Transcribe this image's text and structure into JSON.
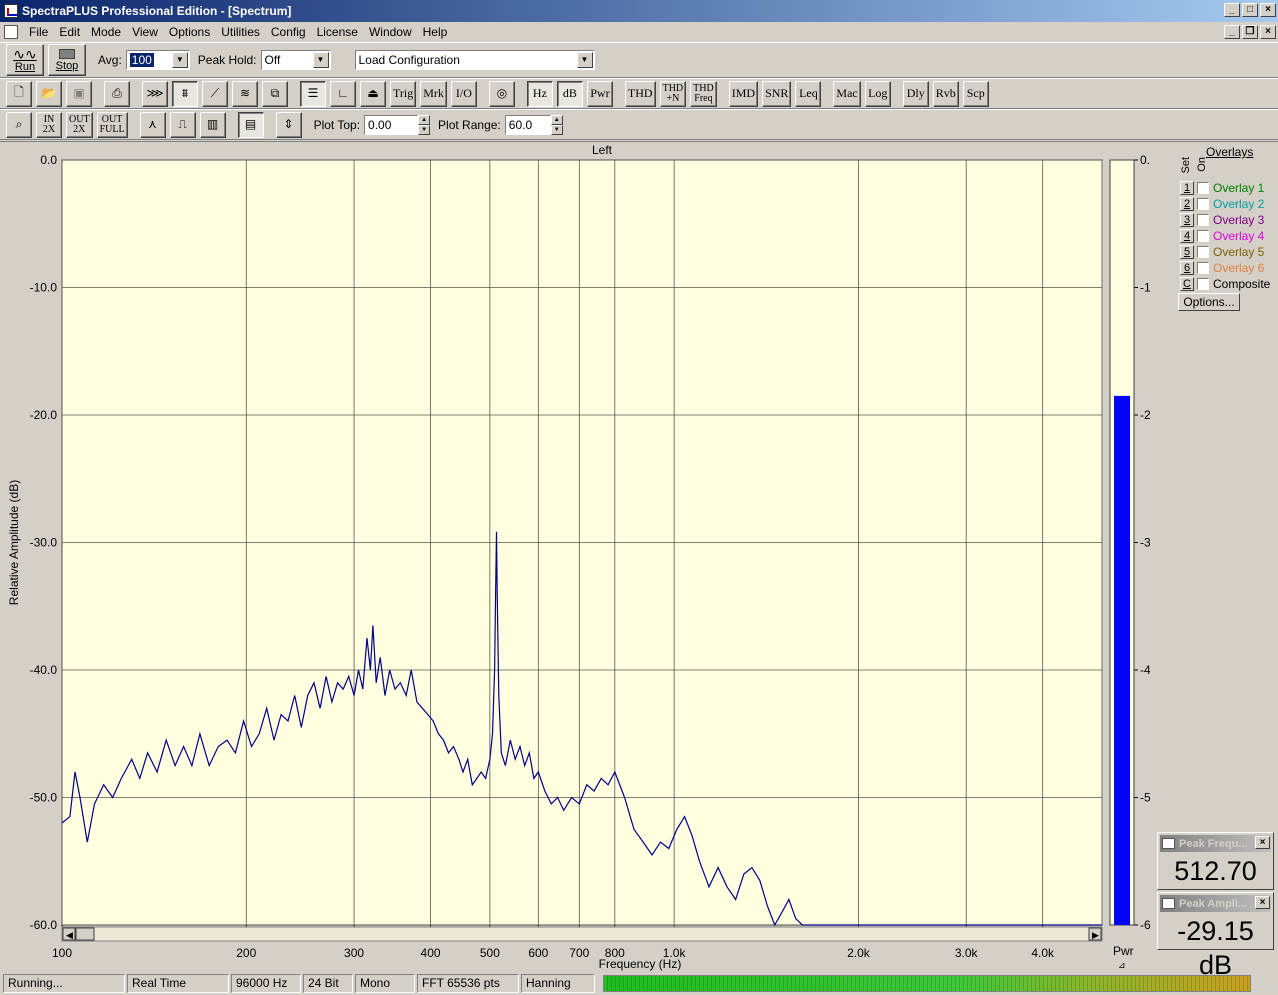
{
  "window": {
    "title": "SpectraPLUS Professional Edition - [Spectrum]"
  },
  "menu": [
    "File",
    "Edit",
    "Mode",
    "View",
    "Options",
    "Utilities",
    "Config",
    "License",
    "Window",
    "Help"
  ],
  "toolbar1": {
    "run_label": "Run",
    "stop_label": "Stop",
    "avg_label": "Avg:",
    "avg_value": "100",
    "peak_hold_label": "Peak Hold:",
    "peak_hold_value": "Off",
    "config_value": "Load Configuration"
  },
  "toolbar2": {
    "text_buttons": [
      "Trig",
      "Mrk",
      "I/O",
      "Hz",
      "dB",
      "Pwr",
      "THD",
      "IMD",
      "SNR",
      "Leq",
      "Mac",
      "Log",
      "Dly",
      "Rvb",
      "Scp"
    ],
    "thdn_top": "THD",
    "thdn_bottom": "+N",
    "thdfreq_top": "THD",
    "thdfreq_bottom": "Freq"
  },
  "toolbar3": {
    "zoom_in_label": [
      "IN",
      "2X"
    ],
    "zoom_out_label": [
      "OUT",
      "2X"
    ],
    "zoom_full_label": [
      "OUT",
      "FULL"
    ],
    "plot_top_label": "Plot Top:",
    "plot_top_value": "0.00",
    "plot_range_label": "Plot Range:",
    "plot_range_value": "60.0"
  },
  "overlays": {
    "title": "Overlays",
    "set_label": "Set",
    "on_label": "On",
    "items": [
      {
        "set": "1",
        "name": "Overlay 1",
        "color": "#008000"
      },
      {
        "set": "2",
        "name": "Overlay 2",
        "color": "#00a0a0"
      },
      {
        "set": "3",
        "name": "Overlay 3",
        "color": "#800080"
      },
      {
        "set": "4",
        "name": "Overlay 4",
        "color": "#e000e0"
      },
      {
        "set": "5",
        "name": "Overlay 5",
        "color": "#806000"
      },
      {
        "set": "6",
        "name": "Overlay 6",
        "color": "#e08040"
      },
      {
        "set": "C",
        "name": "Composite",
        "color": "#000000"
      }
    ],
    "options_label": "Options..."
  },
  "peak_freq": {
    "title": "Peak Frequ...",
    "value": "512.70 Hz"
  },
  "peak_amp": {
    "title": "Peak Ampli...",
    "value": "-29.15 dB"
  },
  "status": {
    "state": "Running...",
    "mode": "Real Time",
    "rate": "96000 Hz",
    "bits": "24 Bit",
    "channels": "Mono",
    "fft": "FFT 65536 pts",
    "window": "Hanning"
  },
  "chart_data": {
    "type": "line",
    "title": "Left",
    "xlabel": "Frequency (Hz)",
    "ylabel": "Relative Amplitude (dB)",
    "x_scale": "log",
    "xlim": [
      100,
      5000
    ],
    "ylim": [
      -60,
      0
    ],
    "x_ticks": [
      100,
      200,
      300,
      400,
      500,
      600,
      700,
      800,
      1000,
      2000,
      3000,
      4000
    ],
    "x_tick_labels": [
      "100",
      "200",
      "300",
      "400",
      "500",
      "600",
      "700",
      "800",
      "1.0k",
      "2.0k",
      "3.0k",
      "4.0k"
    ],
    "y_ticks": [
      0,
      -10,
      -20,
      -30,
      -40,
      -50,
      -60
    ],
    "y_tick_labels": [
      "0.0",
      "-10.0",
      "-20.0",
      "-30.0",
      "-40.0",
      "-50.0",
      "-60.0"
    ],
    "grid": true,
    "series": [
      {
        "color": "#00008b",
        "points": [
          [
            100,
            -52
          ],
          [
            103,
            -51.5
          ],
          [
            105,
            -48
          ],
          [
            107,
            -50
          ],
          [
            110,
            -53.5
          ],
          [
            113,
            -50.5
          ],
          [
            117,
            -49
          ],
          [
            121,
            -50
          ],
          [
            125,
            -48.5
          ],
          [
            130,
            -47
          ],
          [
            134,
            -48.5
          ],
          [
            138,
            -46.5
          ],
          [
            143,
            -48
          ],
          [
            148,
            -45.5
          ],
          [
            153,
            -47.5
          ],
          [
            158,
            -46
          ],
          [
            163,
            -47.5
          ],
          [
            168,
            -45
          ],
          [
            174,
            -47.5
          ],
          [
            180,
            -46
          ],
          [
            186,
            -45.5
          ],
          [
            192,
            -46.5
          ],
          [
            198,
            -44
          ],
          [
            204,
            -46
          ],
          [
            210,
            -45
          ],
          [
            216,
            -43
          ],
          [
            222,
            -45.5
          ],
          [
            228,
            -43.5
          ],
          [
            234,
            -44
          ],
          [
            240,
            -42
          ],
          [
            246,
            -44.5
          ],
          [
            252,
            -42
          ],
          [
            258,
            -41
          ],
          [
            264,
            -43
          ],
          [
            270,
            -40.5
          ],
          [
            276,
            -42.5
          ],
          [
            282,
            -41
          ],
          [
            288,
            -41.5
          ],
          [
            294,
            -40.5
          ],
          [
            300,
            -42
          ],
          [
            305,
            -40
          ],
          [
            310,
            -41.5
          ],
          [
            315,
            -37.5
          ],
          [
            319,
            -40
          ],
          [
            322,
            -36.5
          ],
          [
            326,
            -41
          ],
          [
            331,
            -39
          ],
          [
            337,
            -42
          ],
          [
            343,
            -40
          ],
          [
            350,
            -41.5
          ],
          [
            357,
            -41
          ],
          [
            365,
            -42
          ],
          [
            372,
            -40
          ],
          [
            380,
            -42.5
          ],
          [
            388,
            -43
          ],
          [
            396,
            -43.5
          ],
          [
            404,
            -44
          ],
          [
            412,
            -45
          ],
          [
            420,
            -45.5
          ],
          [
            428,
            -46.5
          ],
          [
            436,
            -46
          ],
          [
            445,
            -47
          ],
          [
            452,
            -48
          ],
          [
            460,
            -47
          ],
          [
            468,
            -49
          ],
          [
            476,
            -48.5
          ],
          [
            484,
            -48
          ],
          [
            492,
            -48.5
          ],
          [
            500,
            -47
          ],
          [
            505,
            -45
          ],
          [
            509,
            -40
          ],
          [
            511,
            -34
          ],
          [
            512.7,
            -29.15
          ],
          [
            514,
            -34
          ],
          [
            517,
            -42
          ],
          [
            522,
            -46.5
          ],
          [
            530,
            -47.5
          ],
          [
            540,
            -45.5
          ],
          [
            550,
            -47
          ],
          [
            560,
            -46
          ],
          [
            570,
            -47.5
          ],
          [
            580,
            -46.5
          ],
          [
            590,
            -48.5
          ],
          [
            600,
            -48
          ],
          [
            615,
            -49.5
          ],
          [
            630,
            -50.5
          ],
          [
            645,
            -50
          ],
          [
            660,
            -51
          ],
          [
            680,
            -50
          ],
          [
            700,
            -50.5
          ],
          [
            720,
            -49
          ],
          [
            740,
            -49.5
          ],
          [
            760,
            -48.5
          ],
          [
            780,
            -49
          ],
          [
            800,
            -48
          ],
          [
            830,
            -50
          ],
          [
            860,
            -52.5
          ],
          [
            890,
            -53.5
          ],
          [
            920,
            -54.5
          ],
          [
            950,
            -53.5
          ],
          [
            980,
            -54
          ],
          [
            1010,
            -52.5
          ],
          [
            1040,
            -51.5
          ],
          [
            1070,
            -53
          ],
          [
            1100,
            -55
          ],
          [
            1140,
            -57
          ],
          [
            1180,
            -55.5
          ],
          [
            1220,
            -57
          ],
          [
            1260,
            -58
          ],
          [
            1300,
            -56
          ],
          [
            1340,
            -55.5
          ],
          [
            1380,
            -56.5
          ],
          [
            1420,
            -58.5
          ],
          [
            1460,
            -60
          ],
          [
            1500,
            -59
          ],
          [
            1540,
            -58
          ],
          [
            1580,
            -59.5
          ],
          [
            1620,
            -60
          ],
          [
            1700,
            -60
          ],
          [
            2000,
            -60
          ],
          [
            3000,
            -60
          ],
          [
            4000,
            -60
          ],
          [
            5000,
            -60
          ]
        ]
      }
    ],
    "level_meter": {
      "label": "Pwr",
      "value_db": -18.5,
      "color": "#0000ff"
    }
  }
}
